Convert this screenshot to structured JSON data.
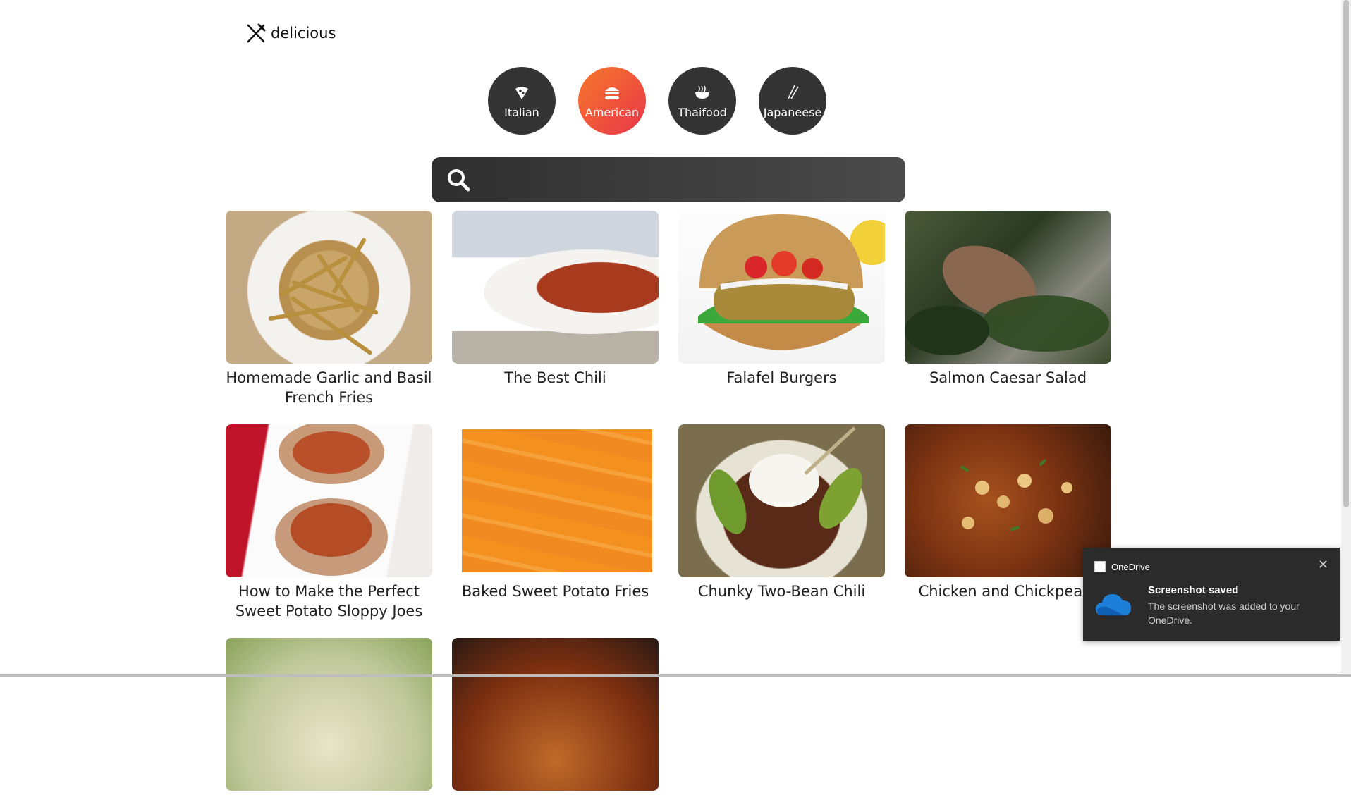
{
  "logo": {
    "text": "delicious",
    "icon": "fork-knife-icon"
  },
  "categories": [
    {
      "label": "Italian",
      "icon": "pizza-icon",
      "active": false
    },
    {
      "label": "American",
      "icon": "burger-icon",
      "active": true
    },
    {
      "label": "Thaifood",
      "icon": "noodle-bowl-icon",
      "active": false
    },
    {
      "label": "Japaneese",
      "icon": "chopsticks-icon",
      "active": false
    }
  ],
  "search": {
    "value": "",
    "placeholder": "",
    "icon": "search-icon"
  },
  "recipes": [
    {
      "title": "Homemade Garlic and Basil French Fries"
    },
    {
      "title": "The Best Chili"
    },
    {
      "title": "Falafel Burgers"
    },
    {
      "title": "Salmon Caesar Salad"
    },
    {
      "title": "How to Make the Perfect Sweet Potato Sloppy Joes"
    },
    {
      "title": "Baked Sweet Potato Fries"
    },
    {
      "title": "Chunky Two-Bean Chili"
    },
    {
      "title": "Chicken and Chickpea C"
    },
    {
      "title": ""
    },
    {
      "title": ""
    }
  ],
  "notification": {
    "app": "OneDrive",
    "title": "Screenshot saved",
    "message": "The screenshot was added to your OneDrive.",
    "close_symbol": "✕"
  },
  "colors": {
    "active_gradient_start": "#f6792a",
    "active_gradient_end": "#e8354a",
    "category_bg": "#343434",
    "search_bg": "#3a3a3a",
    "toast_bg": "#2b2b2b"
  }
}
